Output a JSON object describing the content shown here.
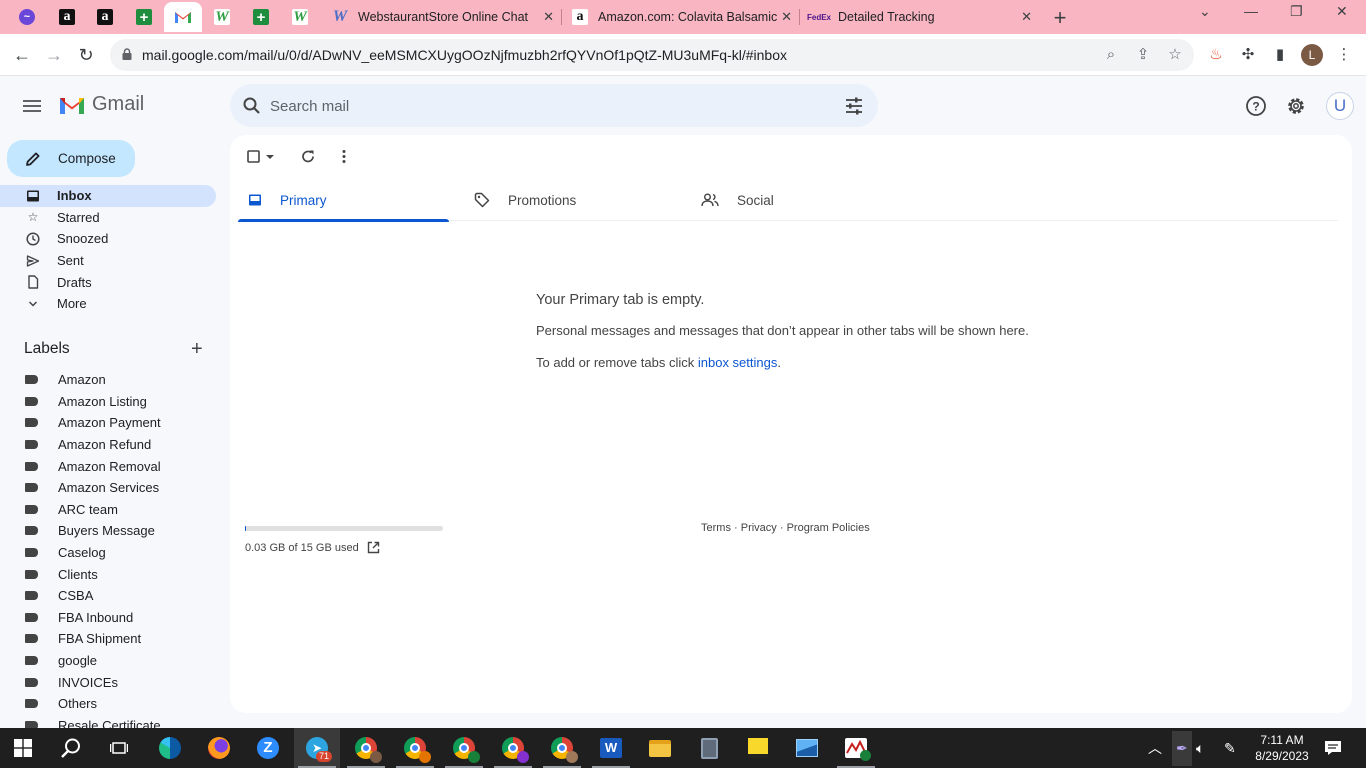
{
  "browser": {
    "tabs": [
      {
        "title": "WebstaurantStore Online Chat"
      },
      {
        "title": "Amazon.com: Colavita Balsamic G"
      },
      {
        "title": "Detailed Tracking"
      }
    ],
    "url": "mail.google.com/mail/u/0/d/ADwNV_eeMSMCXUygOOzNjfmuzbh2rfQYVnOf1pQtZ-MU3uMFq-kl/#inbox",
    "profile_initial": "L",
    "accent": "#f9b6c2"
  },
  "gmail": {
    "app_name": "Gmail",
    "search_placeholder": "Search mail",
    "account_initial": "U",
    "compose_label": "Compose",
    "nav": [
      {
        "label": "Inbox",
        "icon": "inbox-icon"
      },
      {
        "label": "Starred",
        "icon": "star-icon"
      },
      {
        "label": "Snoozed",
        "icon": "clock-icon"
      },
      {
        "label": "Sent",
        "icon": "send-icon"
      },
      {
        "label": "Drafts",
        "icon": "draft-icon"
      },
      {
        "label": "More",
        "icon": "chevron-down-icon"
      }
    ],
    "labels_heading": "Labels",
    "labels": [
      "Amazon",
      "Amazon Listing",
      "Amazon Payment",
      "Amazon Refund",
      "Amazon Removal",
      "Amazon Services",
      "ARC team",
      "Buyers Message",
      "Caselog",
      "Clients",
      "CSBA",
      "FBA Inbound",
      "FBA Shipment",
      "google",
      "INVOICEs",
      "Others",
      "Resale Certificate"
    ],
    "tabs": [
      {
        "label": "Primary"
      },
      {
        "label": "Promotions"
      },
      {
        "label": "Social"
      }
    ],
    "empty": {
      "title": "Your Primary tab is empty.",
      "description": "Personal messages and messages that don’t appear in other tabs will be shown here.",
      "tip_prefix": "To add or remove tabs click ",
      "tip_link": "inbox settings",
      "tip_suffix": "."
    },
    "storage": {
      "text": "0.03 GB of 15 GB used",
      "used_fraction": 0.002
    },
    "footer": {
      "terms": "Terms",
      "privacy": "Privacy",
      "policies": "Program Policies",
      "sep": " · "
    }
  },
  "taskbar": {
    "telegram_badge": "71",
    "time": "7:11 AM",
    "date": "8/29/2023"
  }
}
